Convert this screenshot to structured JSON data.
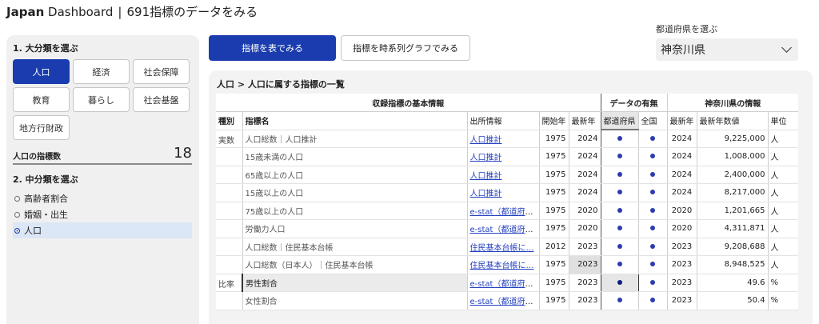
{
  "header": {
    "brand": "Japan",
    "app": "Dashboard",
    "subtitle": "691指標のデータをみる"
  },
  "sidebar": {
    "major_heading": "1. 大分類を選ぶ",
    "categories": [
      {
        "label": "人口",
        "active": true
      },
      {
        "label": "経済",
        "active": false
      },
      {
        "label": "社会保障",
        "active": false
      },
      {
        "label": "教育",
        "active": false
      },
      {
        "label": "暮らし",
        "active": false
      },
      {
        "label": "社会基盤",
        "active": false
      },
      {
        "label": "地方行財政",
        "active": false
      }
    ],
    "count_label": "人口の指標数",
    "count_value": "18",
    "minor_heading": "2. 中分類を選ぶ",
    "subcategories": [
      {
        "label": "高齢者割合",
        "selected": false
      },
      {
        "label": "婚姻・出生",
        "selected": false
      },
      {
        "label": "人口",
        "selected": true
      }
    ]
  },
  "view_buttons": {
    "table": "指標を表でみる",
    "timeseries": "指標を時系列グラフでみる"
  },
  "prefecture": {
    "label": "都道府県を選ぶ",
    "value": "神奈川県"
  },
  "main": {
    "breadcrumb": "人口 > 人口に属する指標の一覧",
    "groups": {
      "basic": "収録指標の基本情報",
      "availability": "データの有無",
      "prefinfo": "神奈川県の情報"
    },
    "columns": {
      "kind": "種別",
      "name": "指標名",
      "source": "出所情報",
      "start": "開始年",
      "latest": "最新年",
      "pref": "都道府県",
      "national": "全国",
      "pref_latest": "最新年",
      "pref_value": "最新年数値",
      "unit": "単位"
    },
    "rows": [
      {
        "kind": "実数",
        "name": "人口総数｜人口推計",
        "source": "人口推計",
        "start": "1975",
        "latest": "2024",
        "pref_year": "2024",
        "value": "9,225,000",
        "unit": "人"
      },
      {
        "kind": "",
        "name": "15歳未満の人口",
        "source": "人口推計",
        "start": "1975",
        "latest": "2024",
        "pref_year": "2024",
        "value": "1,008,000",
        "unit": "人"
      },
      {
        "kind": "",
        "name": "65歳以上の人口",
        "source": "人口推計",
        "start": "1975",
        "latest": "2024",
        "pref_year": "2024",
        "value": "2,400,000",
        "unit": "人"
      },
      {
        "kind": "",
        "name": "15歳以上の人口",
        "source": "人口推計",
        "start": "1975",
        "latest": "2024",
        "pref_year": "2024",
        "value": "8,217,000",
        "unit": "人"
      },
      {
        "kind": "",
        "name": "75歳以上の人口",
        "source": "e-stat（都道府県…",
        "start": "1975",
        "latest": "2020",
        "pref_year": "2020",
        "value": "1,201,665",
        "unit": "人"
      },
      {
        "kind": "",
        "name": "労働力人口",
        "source": "e-stat（都道府県…",
        "start": "1975",
        "latest": "2020",
        "pref_year": "2020",
        "value": "4,311,871",
        "unit": "人"
      },
      {
        "kind": "",
        "name": "人口総数｜住民基本台帳",
        "source": "住民基本台帳に…",
        "start": "2012",
        "latest": "2023",
        "pref_year": "2023",
        "value": "9,208,688",
        "unit": "人"
      },
      {
        "kind": "",
        "name": "人口総数（日本人）｜住民基本台帳",
        "source": "住民基本台帳に…",
        "start": "1975",
        "latest": "2023",
        "pref_year": "2023",
        "value": "8,948,525",
        "unit": "人"
      },
      {
        "kind": "比率",
        "name": "男性割合",
        "source": "e-stat（都道府県…",
        "start": "1975",
        "latest": "2023",
        "pref_year": "2023",
        "value": "49.6",
        "unit": "%"
      },
      {
        "kind": "",
        "name": "女性割合",
        "source": "e-stat（都道府県…",
        "start": "1975",
        "latest": "2023",
        "pref_year": "2023",
        "value": "50.4",
        "unit": "%"
      }
    ]
  }
}
